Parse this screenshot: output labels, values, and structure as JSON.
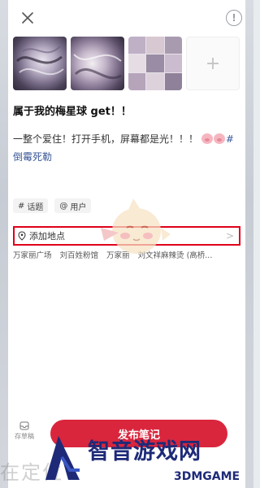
{
  "header": {
    "close_icon": "close-icon",
    "info_icon": "info-icon",
    "info_glyph": "!"
  },
  "images": [
    {
      "name": "planet-image-1"
    },
    {
      "name": "planet-image-2"
    },
    {
      "name": "collage-image"
    },
    {
      "name": "add-image",
      "glyph": "+"
    }
  ],
  "post": {
    "title": "属于我的梅星球 get！！",
    "body": "一整个爱住！打开手机，屏幕都是光！！！",
    "hashtag": "#倒霉死勒"
  },
  "chips": [
    {
      "icon": "#",
      "label": "话题"
    },
    {
      "icon": "@",
      "label": "用户"
    }
  ],
  "location": {
    "label": "添加地点",
    "suggestions": [
      "万家丽广场",
      "刘百姓粉馆",
      "万家丽",
      "刘文祥麻辣烫 (高桥..."
    ]
  },
  "footer": {
    "draft_label": "存草稿",
    "publish_label": "发布笔记"
  },
  "watermark": {
    "ghost": "在定位",
    "brand": "智音游戏网",
    "sub": "3DMGAME"
  },
  "colors": {
    "accent": "#d9263d",
    "highlight_border": "#e0001b",
    "hashtag": "#3b5998"
  }
}
